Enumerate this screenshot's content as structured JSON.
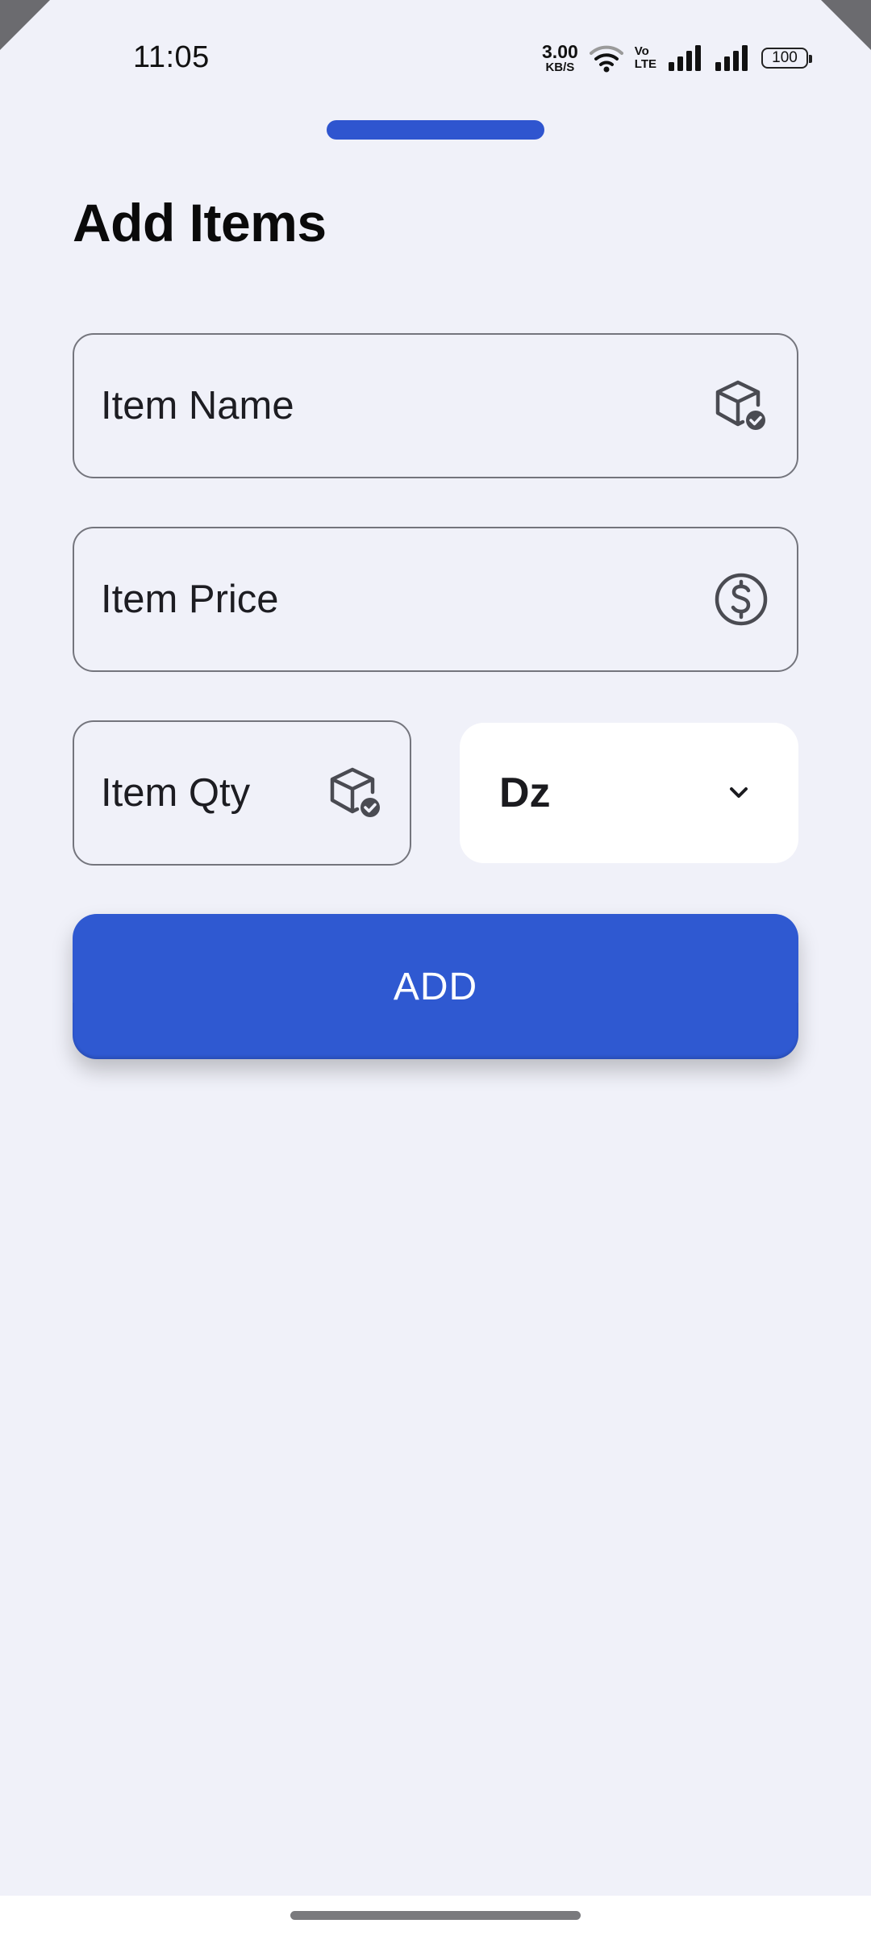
{
  "status_bar": {
    "time": "11:05",
    "net_speed_value": "3.00",
    "net_speed_unit": "KB/S",
    "volte_line1": "Vo",
    "volte_line2": "LTE",
    "battery": "100",
    "icons": [
      "wifi-icon",
      "signal-icon",
      "signal-icon",
      "battery-icon"
    ]
  },
  "sheet": {
    "title": "Add Items",
    "accent_color": "#2f59d1"
  },
  "form": {
    "item_name": {
      "placeholder": "Item Name",
      "value": "",
      "icon": "box-check-icon"
    },
    "item_price": {
      "placeholder": "Item Price",
      "value": "",
      "icon": "dollar-circle-icon"
    },
    "item_qty": {
      "placeholder": "Item Qty",
      "value": "",
      "icon": "box-check-icon"
    },
    "unit": {
      "selected": "Dz",
      "icon": "chevron-down-icon"
    }
  },
  "actions": {
    "add_label": "ADD"
  }
}
